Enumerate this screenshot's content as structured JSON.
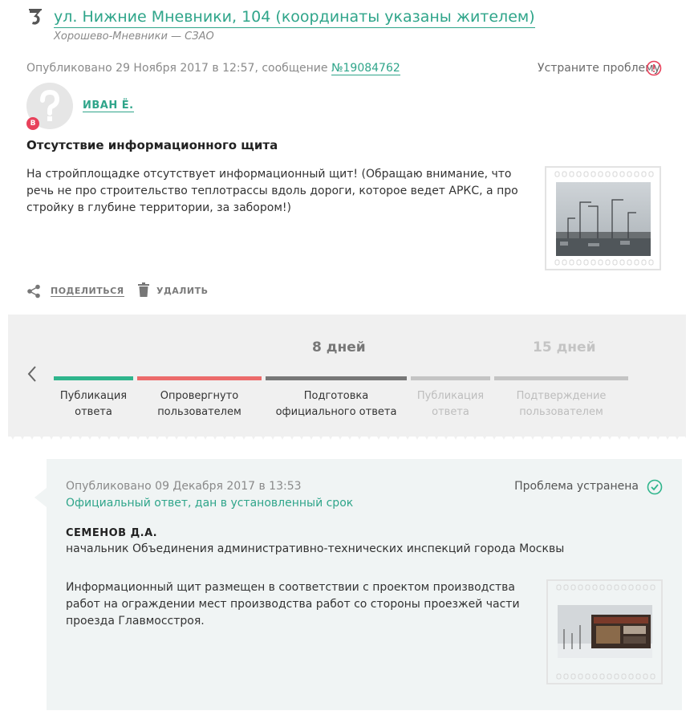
{
  "header": {
    "address": "ул. Нижние Мневники, 104 (координаты указаны жителем)",
    "district": "Хорошево-Мневники — СЗАО"
  },
  "post": {
    "published_prefix": "Опубликовано 29 Ноября 2017 в 12:57, сообщение",
    "message_number": "№19084762",
    "fix_problem": "Устраните проблему",
    "avatar_badge": "В",
    "author": "ИВАН Ё.",
    "title": "Отсутствие информационного щита",
    "body": "На стройплощадке отсутствует информационный щит! (Обращаю внимание, что речь не про строительство теплотрассы вдоль дороги, которое ведет АРКС, а про стройку в глубине территории, за забором!)",
    "share_label": "ПОДЕЛИТЬСЯ",
    "delete_label": "УДАЛИТЬ"
  },
  "timeline": {
    "day_labels": [
      "8 дней",
      "15 дней"
    ],
    "steps": [
      {
        "label": "Публикация ответа",
        "color": "#2fb58c",
        "active": true
      },
      {
        "label": "Опровергнуто пользователем",
        "color": "#ec6b6b",
        "active": true
      },
      {
        "label": "Подготовка официального ответа",
        "color": "#777777",
        "active": true
      },
      {
        "label": "Публикация ответа",
        "color": "#c4c4c4",
        "active": false
      },
      {
        "label": "Подтверждение пользователем",
        "color": "#c4c4c4",
        "active": false
      }
    ]
  },
  "answer": {
    "published": "Опубликовано 09 Декабря 2017 в 13:53",
    "subtitle": "Официальный ответ, дан в установленный срок",
    "status": "Проблема устранена",
    "name": "СЕМЕНОВ Д.А.",
    "position": "начальник Объединения административно-технических инспекций города Москвы",
    "body": "Информационный щит размещен в соответствии с проектом производства работ на ограждении мест производства работ со стороны проезжей части проезда Главмосстроя."
  },
  "icons": {
    "logo": "city-logo-icon",
    "fix": "exclamation-circle-icon",
    "share": "share-icon",
    "delete": "trash-icon",
    "prev": "chevron-left-icon",
    "status": "check-circle-icon"
  },
  "colors": {
    "accent": "#2fa58a",
    "alert": "#e8415b"
  }
}
